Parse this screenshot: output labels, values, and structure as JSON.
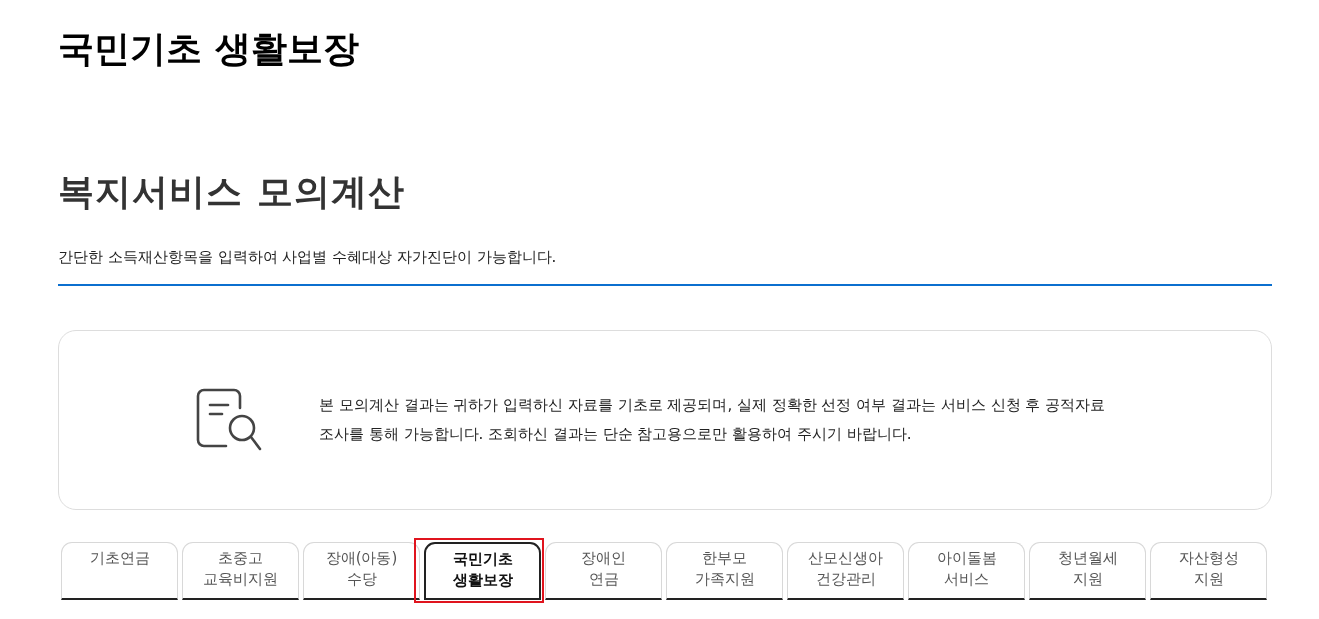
{
  "header": {
    "title": "국민기초 생활보장"
  },
  "section": {
    "title": "복지서비스 모의계산",
    "description": "간단한 소득재산항목을 입력하여 사업별 수혜대상 자가진단이 가능합니다."
  },
  "notice": {
    "text": "본 모의계산 결과는 귀하가 입력하신 자료를 기초로 제공되며, 실제 정확한 선정 여부 결과는 서비스 신청 후 공적자료 조사를 통해 가능합니다. 조회하신 결과는 단순 참고용으로만 활용하여 주시기 바랍니다."
  },
  "tabs": [
    {
      "label": "기초연금",
      "selected": false,
      "focused": false
    },
    {
      "label": "초중고\n교육비지원",
      "selected": false,
      "focused": false
    },
    {
      "label": "장애(아동)\n수당",
      "selected": false,
      "focused": false
    },
    {
      "label": "국민기초\n생활보장",
      "selected": true,
      "focused": true
    },
    {
      "label": "장애인\n연금",
      "selected": false,
      "focused": false
    },
    {
      "label": "한부모\n가족지원",
      "selected": false,
      "focused": false
    },
    {
      "label": "산모신생아\n건강관리",
      "selected": false,
      "focused": false
    },
    {
      "label": "아이돌봄\n서비스",
      "selected": false,
      "focused": false
    },
    {
      "label": "청년월세\n지원",
      "selected": false,
      "focused": false
    },
    {
      "label": "자산형성\n지원",
      "selected": false,
      "focused": false
    }
  ]
}
